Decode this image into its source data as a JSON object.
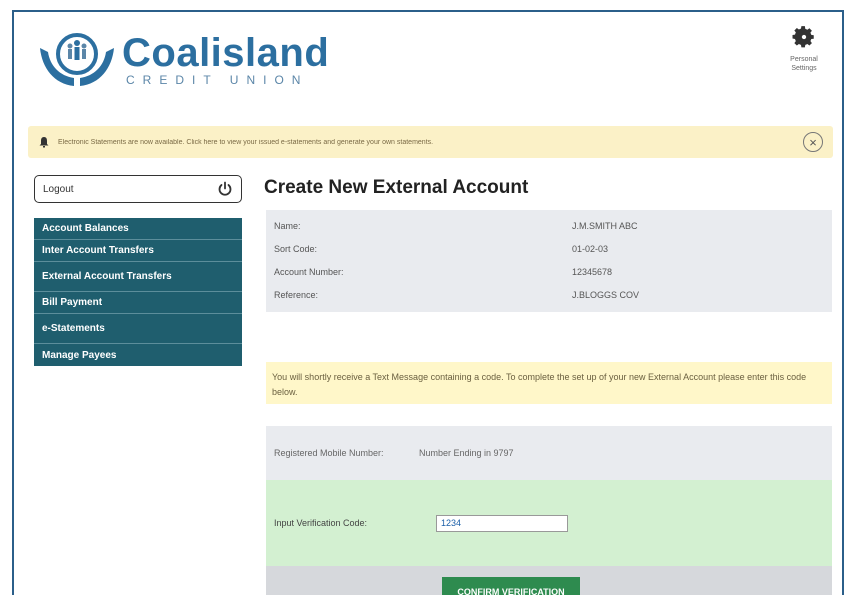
{
  "brand": {
    "name": "Coalisland",
    "tagline": "CREDIT UNION",
    "colors": {
      "primary": "#2c6fa0",
      "nav": "#1f5e6e",
      "confirm": "#2e8b4f"
    }
  },
  "header": {
    "preferences_label": "Personal Settings",
    "preferences_icon": "gear-icon"
  },
  "notice": {
    "icon": "bell-icon",
    "text": "Electronic Statements are now available. Click here to view your issued e-statements and generate your own statements.",
    "close_icon": "close-icon"
  },
  "sidebar": {
    "logout_label": "Logout",
    "logout_icon": "power-icon",
    "items": [
      {
        "label": "Account Balances"
      },
      {
        "label": "Inter Account Transfers"
      },
      {
        "label": "External Account Transfers"
      },
      {
        "label": "Bill Payment"
      },
      {
        "label": "e-Statements"
      },
      {
        "label": "Manage Payees"
      }
    ]
  },
  "main": {
    "title": "Create New External Account",
    "details": [
      {
        "label": "Name:",
        "value": "J.M.SMITH ABC"
      },
      {
        "label": "Sort Code:",
        "value": "01-02-03"
      },
      {
        "label": "Account Number:",
        "value": "12345678"
      },
      {
        "label": "Reference:",
        "value": "J.BLOGGS COV"
      }
    ],
    "info_text": "You will shortly receive a Text Message containing a code. To complete the set up of your new External Account please enter this code below.",
    "mobile": {
      "label": "Registered Mobile Number:",
      "value": "Number Ending in 9797"
    },
    "verification": {
      "label": "Input Verification Code:",
      "value": "1234"
    },
    "confirm_label": "CONFIRM VERIFICATION"
  }
}
